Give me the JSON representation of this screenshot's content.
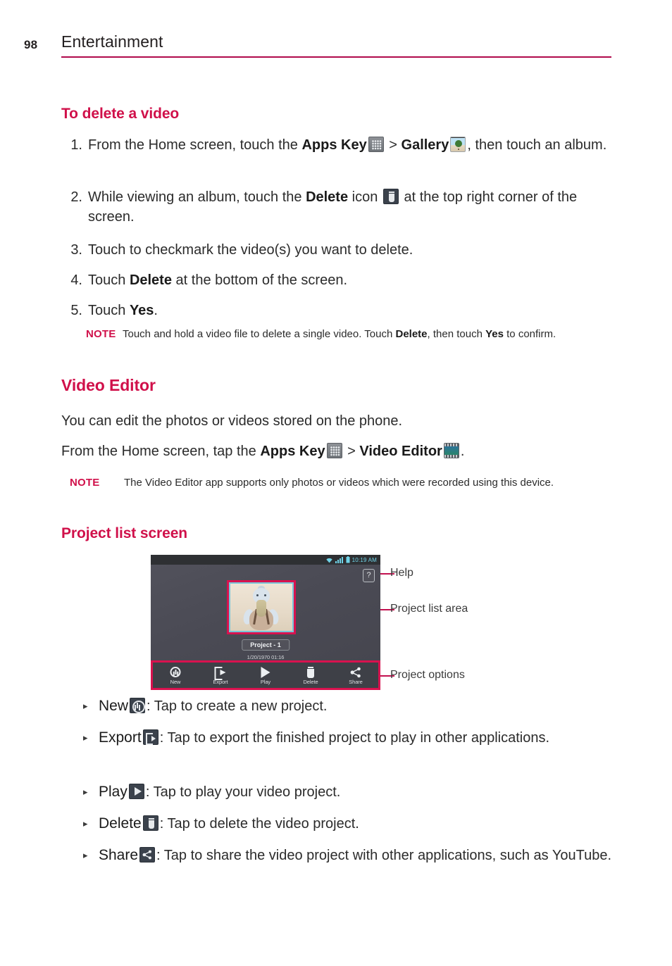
{
  "header": {
    "page_number": "98",
    "title": "Entertainment",
    "rule_color": "#b00a4c"
  },
  "sections": {
    "delete_video": {
      "heading": "To delete a video",
      "steps": [
        {
          "number": "1.",
          "text_before": "From the Home screen, touch the ",
          "bold_1": "Apps Key",
          "icon_1": "apps-key-icon",
          "separator": " > ",
          "bold_2": "Gallery",
          "icon_2": "gallery-icon",
          "text_after": ", then touch an album."
        },
        {
          "number": "2.",
          "text_before": "While viewing an album, touch the ",
          "bold_1": "Delete",
          "text_mid": " icon ",
          "icon_1": "delete-trash-icon",
          "text_after": " at the top right corner of the screen."
        },
        {
          "number": "3.",
          "text": "Touch to checkmark the video(s) you want to delete."
        },
        {
          "number": "4.",
          "text_before": "Touch ",
          "bold_1": "Delete",
          "text_after": " at the bottom of the screen."
        },
        {
          "number": "5.",
          "text_before": "Touch ",
          "bold_1": "Yes",
          "text_after": "."
        }
      ],
      "note": {
        "label": "NOTE",
        "part_1": "Touch and hold a video file to delete a single video. Touch ",
        "bold_1": "Delete",
        "part_2": ", then touch ",
        "bold_2": "Yes",
        "part_3": " to confirm."
      }
    },
    "video_editor": {
      "heading": "Video Editor",
      "intro": "You can edit the photos or videos stored on the phone.",
      "path": {
        "text_before": "From the Home screen, tap the ",
        "bold_1": "Apps Key",
        "icon_1": "apps-key-icon",
        "separator": " > ",
        "bold_2": "Video Editor",
        "icon_2": "video-editor-icon",
        "text_after": "."
      },
      "note": {
        "label": "NOTE",
        "text": "The Video Editor app supports only photos or videos which were recorded using this device."
      }
    },
    "project_list": {
      "heading": "Project list screen",
      "figure": {
        "status_bar": {
          "time": "10:19 AM",
          "icons": [
            "wifi-icon",
            "signal-bars-icon",
            "battery-icon"
          ],
          "icon_color": "#6fd3e8"
        },
        "help_button": {
          "glyph": "?",
          "name": "help-button"
        },
        "project": {
          "name": "Project - 1",
          "date": "1/20/1970 01:16",
          "thumbnail": "plush-duck-photo"
        },
        "toolbar": [
          {
            "label": "New",
            "icon": "plus-circle-icon"
          },
          {
            "label": "Export",
            "icon": "export-arrow-icon"
          },
          {
            "label": "Play",
            "icon": "play-triangle-icon"
          },
          {
            "label": "Delete",
            "icon": "trash-icon"
          },
          {
            "label": "Share",
            "icon": "share-nodes-icon"
          }
        ],
        "annotation_color": "#d8124f"
      },
      "callouts": [
        {
          "label": "Help"
        },
        {
          "label": "Project list area"
        },
        {
          "label": "Project options"
        }
      ],
      "bullets": [
        {
          "term": "New",
          "icon": "plus-circle-icon",
          "description": ": Tap to create a new project."
        },
        {
          "term": "Export",
          "icon": "export-arrow-icon",
          "description": ": Tap to export the finished project to play in other applications."
        },
        {
          "term": "Play",
          "icon": "play-triangle-icon",
          "description": ": Tap to play your video project."
        },
        {
          "term": "Delete",
          "icon": "trash-icon",
          "description": ": Tap to delete the video project."
        },
        {
          "term": "Share",
          "icon": "share-nodes-icon",
          "description": ": Tap to share the video project with other applications, such as YouTube."
        }
      ]
    }
  },
  "colors": {
    "brand_magenta": "#d0104a",
    "rule_magenta": "#b00a4c",
    "annotation_magenta": "#d8124f",
    "status_cyan": "#6fd3e8",
    "body_text": "#2b2b2b"
  }
}
